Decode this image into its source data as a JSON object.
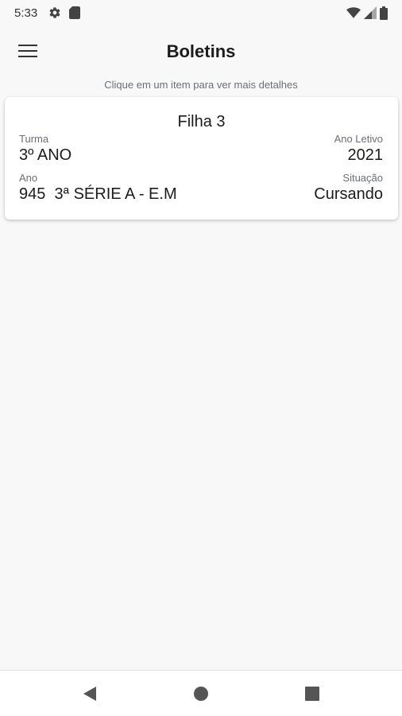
{
  "status_bar": {
    "time": "5:33",
    "icons": [
      "gear-icon",
      "sd-card-icon",
      "wifi-icon",
      "signal-icon",
      "battery-icon"
    ]
  },
  "app_bar": {
    "title": "Boletins",
    "menu_icon": "hamburger-menu-icon"
  },
  "hint": "Clique em um item para ver mais detalhes",
  "cards": [
    {
      "title": "Filha 3",
      "turma_label": "Turma",
      "turma_value": "3º ANO",
      "ano_letivo_label": "Ano Letivo",
      "ano_letivo_value": "2021",
      "ano_label": "Ano",
      "ano_value": "945  3ª SÉRIE A - E.M",
      "situacao_label": "Situação",
      "situacao_value": "Cursando"
    }
  ],
  "nav_bar": {
    "buttons": [
      "back-icon",
      "home-icon",
      "recents-icon"
    ]
  },
  "colors": {
    "background": "#f8f8f9",
    "card": "#ffffff",
    "text_primary": "#1c1c1c",
    "text_secondary": "#6a6f76"
  }
}
